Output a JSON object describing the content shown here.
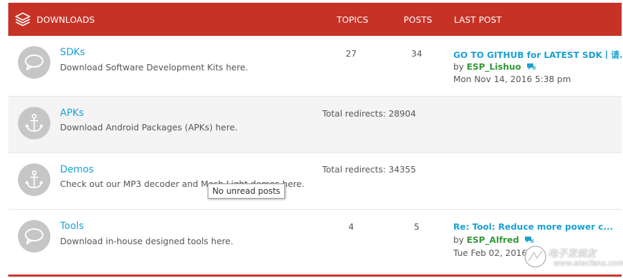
{
  "header": {
    "title": "DOWNLOADS",
    "col_topics": "TOPICS",
    "col_posts": "POSTS",
    "col_last_post": "LAST POST",
    "icon": "layers-icon",
    "color": "#c73226"
  },
  "forums": [
    {
      "name": "SDKs",
      "description": "Download Software Development Kits here.",
      "icon": "speech-bubble-icon",
      "topics": "27",
      "posts": "34",
      "last_post": {
        "title": "GO TO GITHUB for LATEST SDK丨请...",
        "by": "by",
        "user": "ESP_Lishuo",
        "date": "Mon Nov 14, 2016 5:38 pm"
      }
    },
    {
      "name": "APKs",
      "description": "Download Android Packages (APKs) here.",
      "icon": "anchor-icon",
      "redirects": "Total redirects: 28904"
    },
    {
      "name": "Demos",
      "description": "Check out our MP3 decoder and Mesh Light demos here.",
      "icon": "anchor-icon",
      "redirects": "Total redirects: 34355"
    },
    {
      "name": "Tools",
      "description": "Download in-house designed tools here.",
      "icon": "speech-bubble-icon",
      "topics": "4",
      "posts": "5",
      "last_post": {
        "title": "Re: Tool: Reduce more power c...",
        "by": "by",
        "user": "ESP_Alfred",
        "date": "Tue Feb 02, 2016"
      }
    }
  ],
  "tooltip": "No unread posts",
  "watermark": {
    "text": "电子发烧友",
    "sub": "www.elecfans.com"
  },
  "colors": {
    "link": "#1ba1d2",
    "username": "#2f9a36",
    "icon_circle": "#c6c6c6"
  }
}
